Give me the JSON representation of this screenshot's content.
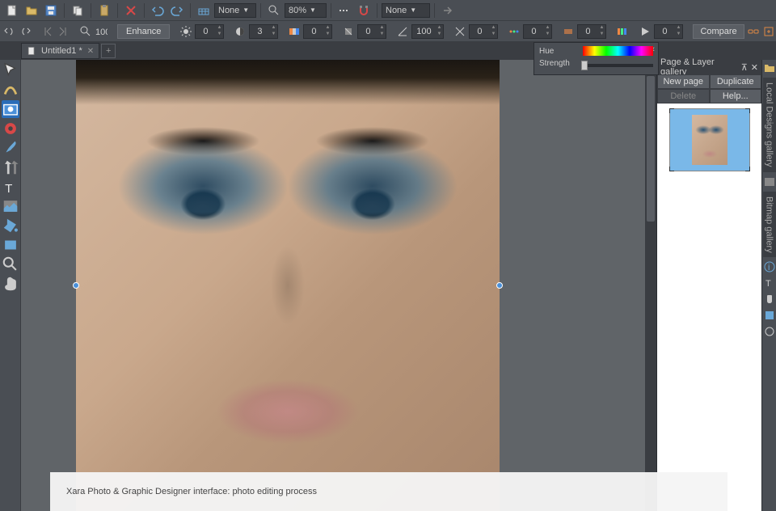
{
  "toolbar1": {
    "snap_mode": "None",
    "zoom": "80%",
    "blend_mode": "None"
  },
  "toolbar2": {
    "enhance_label": "Enhance",
    "brightness": "0",
    "contrast": "3",
    "saturation": "0",
    "temp": "0",
    "sharpness": "100",
    "crossproc": "0",
    "vignette": "0",
    "highlight": "0",
    "shadow": "0",
    "compare_label": "Compare"
  },
  "tabs": {
    "doc1": "Untitled1 *"
  },
  "floating": {
    "hue_label": "Hue",
    "strength_label": "Strength"
  },
  "gallery": {
    "title": "Page & Layer gallery",
    "new_page": "New page",
    "duplicate": "Duplicate",
    "delete": "Delete",
    "help": "Help..."
  },
  "side_tabs": {
    "local": "Local Designs gallery",
    "bitmap": "Bitmap gallery"
  },
  "caption": "Xara Photo & Graphic Designer interface: photo editing process"
}
